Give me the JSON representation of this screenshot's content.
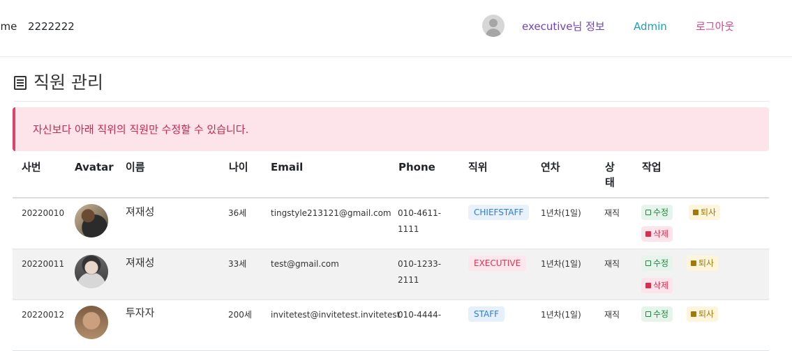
{
  "nav": {
    "home_label": "Home",
    "code": "2222222",
    "user_info": "executive님 정보",
    "admin": "Admin",
    "logout": "로그아웃"
  },
  "page": {
    "title": "직원 관리",
    "alert": "자신보다 아래 직위의 직원만 수정할 수 있습니다."
  },
  "table": {
    "headers": {
      "id": "사번",
      "avatar": "Avatar",
      "name": "이름",
      "age": "나이",
      "email": "Email",
      "phone": "Phone",
      "position": "직위",
      "years": "연차",
      "status1": "상",
      "status2": "태",
      "actions": "작업"
    },
    "rows": [
      {
        "id": "20220010",
        "name": "져재성",
        "age": "36세",
        "email": "tingstyle213121@gmail.com",
        "phone1": "010-4611-",
        "phone2": "1111",
        "position": "CHIEFSTAFF",
        "years": "1년차(1일)",
        "status": "재직",
        "edit": "수정",
        "resign": "퇴사",
        "delete": "삭제"
      },
      {
        "id": "20220011",
        "name": "져재성",
        "age": "33세",
        "email": "test@gmail.com",
        "phone1": "010-1233-",
        "phone2": "2111",
        "position": "EXECUTIVE",
        "years": "1년차(1일)",
        "status": "재직",
        "edit": "수정",
        "resign": "퇴사",
        "delete": "삭제"
      },
      {
        "id": "20220012",
        "name": "투자자",
        "age": "200세",
        "email": "invitetest@invitetest.invitetest",
        "phone1": "010-4444-",
        "position": "STAFF",
        "years": "1년차(1일)",
        "status": "재직",
        "edit": "수정",
        "resign": "퇴사"
      }
    ]
  },
  "icons": [
    "user-avatar-icon",
    "list-icon",
    "edit-icon",
    "trash-icon",
    "document-icon"
  ],
  "colors": {
    "user_info": "#6f42c1",
    "admin": "#17a2b8",
    "logout": "#e83e8c",
    "alert_bg": "#fce4ea",
    "alert_text": "#c6284c"
  }
}
